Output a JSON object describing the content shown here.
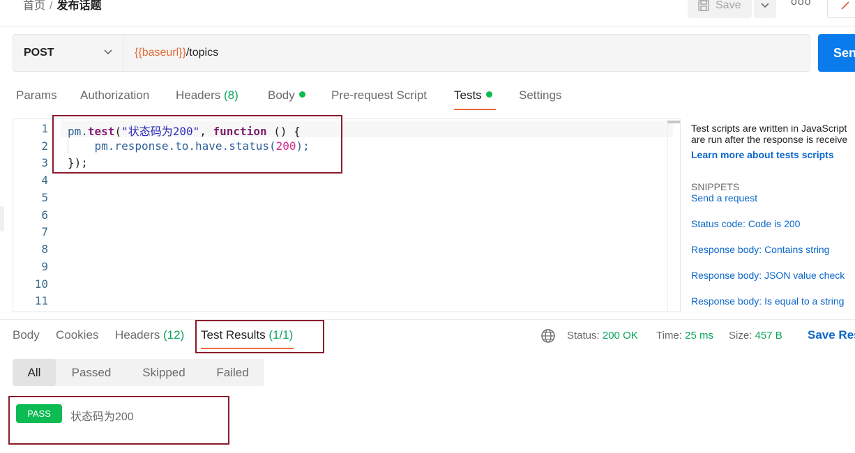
{
  "breadcrumb": {
    "parent": "首页",
    "separator": "/",
    "current": "发布话题"
  },
  "toolbar": {
    "save_label": "Save",
    "more_label": "ooo"
  },
  "request": {
    "method": "POST",
    "url_var": "{{baseurl}}",
    "url_path": "/topics",
    "send_label": "Sen"
  },
  "request_tabs": [
    {
      "label": "Params",
      "count": ""
    },
    {
      "label": "Authorization",
      "count": ""
    },
    {
      "label": "Headers",
      "count": "(8)"
    },
    {
      "label": "Body",
      "count": ""
    },
    {
      "label": "Pre-request Script",
      "count": ""
    },
    {
      "label": "Tests",
      "count": ""
    },
    {
      "label": "Settings",
      "count": ""
    }
  ],
  "editor": {
    "line_numbers": [
      "1",
      "2",
      "3",
      "4",
      "5",
      "6",
      "7",
      "8",
      "9",
      "10",
      "11"
    ],
    "code": {
      "l1_obj": "pm.",
      "l1_fn": "test",
      "l1_paren": "(",
      "l1_str": "\"状态码为200\"",
      "l1_comma": ", ",
      "l1_kw": "function",
      "l1_rest": " () {",
      "l2_indent": "    ",
      "l2_code": "pm.response.to.have.status(",
      "l2_num": "200",
      "l2_end": ");",
      "l3": "});"
    }
  },
  "side_panel": {
    "desc_line1": "Test scripts are written in JavaScript",
    "desc_line2": "are run after the response is receive",
    "learn_more": "Learn more about tests scripts",
    "snippets_heading": "SNIPPETS",
    "snippets": [
      "Send a request",
      "Status code: Code is 200",
      "Response body: Contains string",
      "Response body: JSON value check",
      "Response body: Is equal to a string"
    ]
  },
  "response_tabs": [
    {
      "label": "Body",
      "count": ""
    },
    {
      "label": "Cookies",
      "count": ""
    },
    {
      "label": "Headers",
      "count": "(12)"
    },
    {
      "label": "Test Results",
      "count": "(1/1)"
    }
  ],
  "response_status": {
    "status_label": "Status:",
    "status_value": "200 OK",
    "time_label": "Time:",
    "time_value": "25 ms",
    "size_label": "Size:",
    "size_value": "457 B",
    "save_response": "Save Res"
  },
  "filters": [
    "All",
    "Passed",
    "Skipped",
    "Failed"
  ],
  "results": [
    {
      "badge": "PASS",
      "name": "状态码为200"
    }
  ],
  "colors": {
    "accent": "#f26b3a",
    "send": "#097bed",
    "pass": "#0cbb52",
    "link": "#0a66c9",
    "annotation": "#8a1c2b"
  },
  "icons": [
    "save-icon",
    "chevron-down-icon",
    "more-icon",
    "globe-icon",
    "pen-icon"
  ]
}
